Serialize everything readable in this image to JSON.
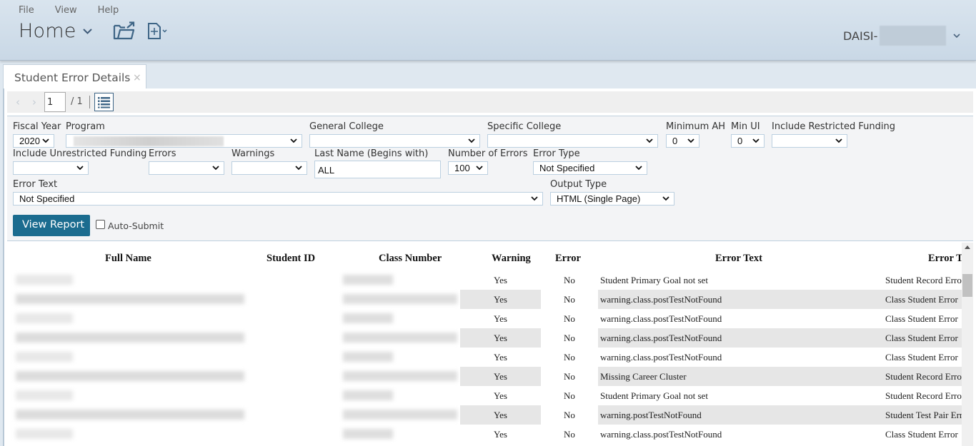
{
  "menu": {
    "file": "File",
    "view": "View",
    "help": "Help"
  },
  "home": {
    "label": "Home"
  },
  "user": {
    "name_prefix": "DAISI-"
  },
  "tab": {
    "label": "Student Error Details",
    "close": "×"
  },
  "toolbar": {
    "prev": "‹",
    "next": "›",
    "page": "1",
    "total": "/ 1"
  },
  "params": {
    "fiscal_year": {
      "label": "Fiscal Year",
      "value": "2020"
    },
    "program": {
      "label": "Program",
      "value": ""
    },
    "general_college": {
      "label": "General College",
      "value": ""
    },
    "specific_college": {
      "label": "Specific College",
      "value": ""
    },
    "minimum_ah": {
      "label": "Minimum AH",
      "value": "0"
    },
    "min_ui": {
      "label": "Min UI",
      "value": "0"
    },
    "include_restricted": {
      "label": "Include Restricted Funding",
      "value": ""
    },
    "include_unrestricted": {
      "label": "Include Unrestricted Funding",
      "value": ""
    },
    "errors": {
      "label": "Errors",
      "value": ""
    },
    "warnings": {
      "label": "Warnings",
      "value": ""
    },
    "last_name": {
      "label": "Last Name (Begins with)",
      "value": "ALL"
    },
    "number_of_errors": {
      "label": "Number of Errors",
      "value": "100"
    },
    "error_type": {
      "label": "Error Type",
      "value": "Not Specified"
    },
    "error_text": {
      "label": "Error Text",
      "value": "Not Specified"
    },
    "output_type": {
      "label": "Output Type",
      "value": "HTML (Single Page)"
    },
    "view_report": "View Report",
    "auto_submit": "Auto-Submit"
  },
  "report": {
    "columns": [
      "Full Name",
      "Student ID",
      "Class Number",
      "Warning",
      "Error",
      "Error Text",
      "Error T"
    ],
    "rows": [
      {
        "warning": "Yes",
        "error": "No",
        "error_text": "Student Primary Goal not set",
        "error_type": "Student Record Error"
      },
      {
        "warning": "Yes",
        "error": "No",
        "error_text": "warning.class.postTestNotFound",
        "error_type": "Class Student Error"
      },
      {
        "warning": "Yes",
        "error": "No",
        "error_text": "warning.class.postTestNotFound",
        "error_type": "Class Student Error"
      },
      {
        "warning": "Yes",
        "error": "No",
        "error_text": "warning.class.postTestNotFound",
        "error_type": "Class Student Error"
      },
      {
        "warning": "Yes",
        "error": "No",
        "error_text": "warning.class.postTestNotFound",
        "error_type": "Class Student Error"
      },
      {
        "warning": "Yes",
        "error": "No",
        "error_text": "Missing Career Cluster",
        "error_type": "Student Record Error"
      },
      {
        "warning": "Yes",
        "error": "No",
        "error_text": "Student Primary Goal not set",
        "error_type": "Student Record Error"
      },
      {
        "warning": "Yes",
        "error": "No",
        "error_text": "warning.postTestNotFound",
        "error_type": "Student Test Pair Error"
      },
      {
        "warning": "Yes",
        "error": "No",
        "error_text": "warning.class.postTestNotFound",
        "error_type": "Class Student Error"
      }
    ]
  },
  "colors": {
    "accent": "#1b6c8f",
    "icon": "#3e6586",
    "row_shade": "#e6e6e6"
  }
}
